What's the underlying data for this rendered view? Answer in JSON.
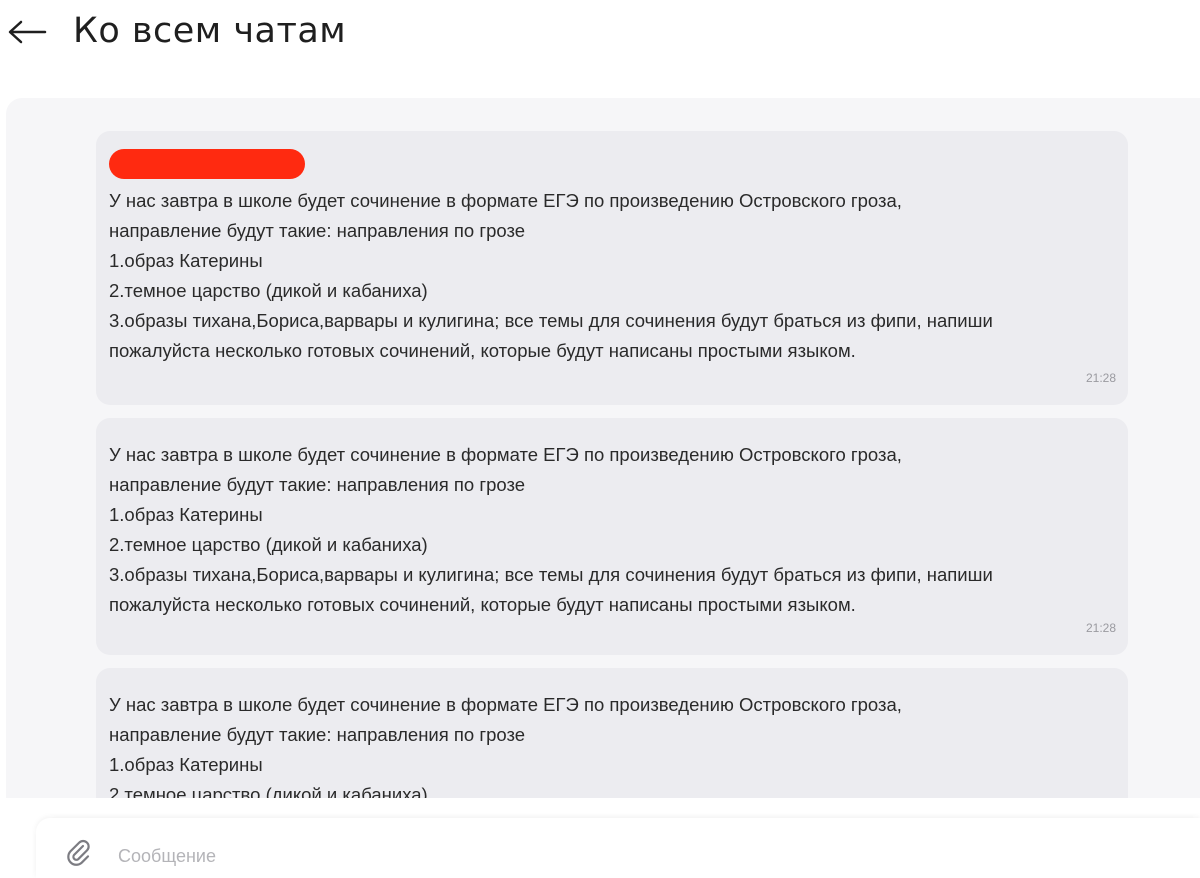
{
  "header": {
    "back_label": "Ко всем чатам"
  },
  "messages": [
    {
      "text": "У нас завтра в школе будет сочинение в формате ЕГЭ по произведению Островского гроза,\nнаправление будут такие: направления по грозе\n1.образ Катерины\n2.темное царство (дикой и кабаниха)\n3.образы тихана,Бориса,варвары и кулигина; все темы для сочинения будут браться из фипи, напиши\nпожалуйста несколько готовых сочинений, которые будут написаны простыми языком.",
      "time": "21:28"
    },
    {
      "text": "У нас завтра в школе будет сочинение в формате ЕГЭ по произведению Островского гроза,\nнаправление будут такие: направления по грозе\n1.образ Катерины\n2.темное царство (дикой и кабаниха)\n3.образы тихана,Бориса,варвары и кулигина; все темы для сочинения будут браться из фипи, напиши\nпожалуйста несколько готовых сочинений, которые будут написаны простыми языком.",
      "time": "21:28"
    },
    {
      "text": "У нас завтра в школе будет сочинение в формате ЕГЭ по произведению Островского гроза,\nнаправление будут такие: направления по грозе\n1.образ Катерины\n2.темное царство (дикой и кабаниха)"
    }
  ],
  "composer": {
    "placeholder": "Сообщение"
  },
  "colors": {
    "redaction": "#ff2a10",
    "bubble": "#ececf0",
    "panel": "#f6f6f8"
  }
}
